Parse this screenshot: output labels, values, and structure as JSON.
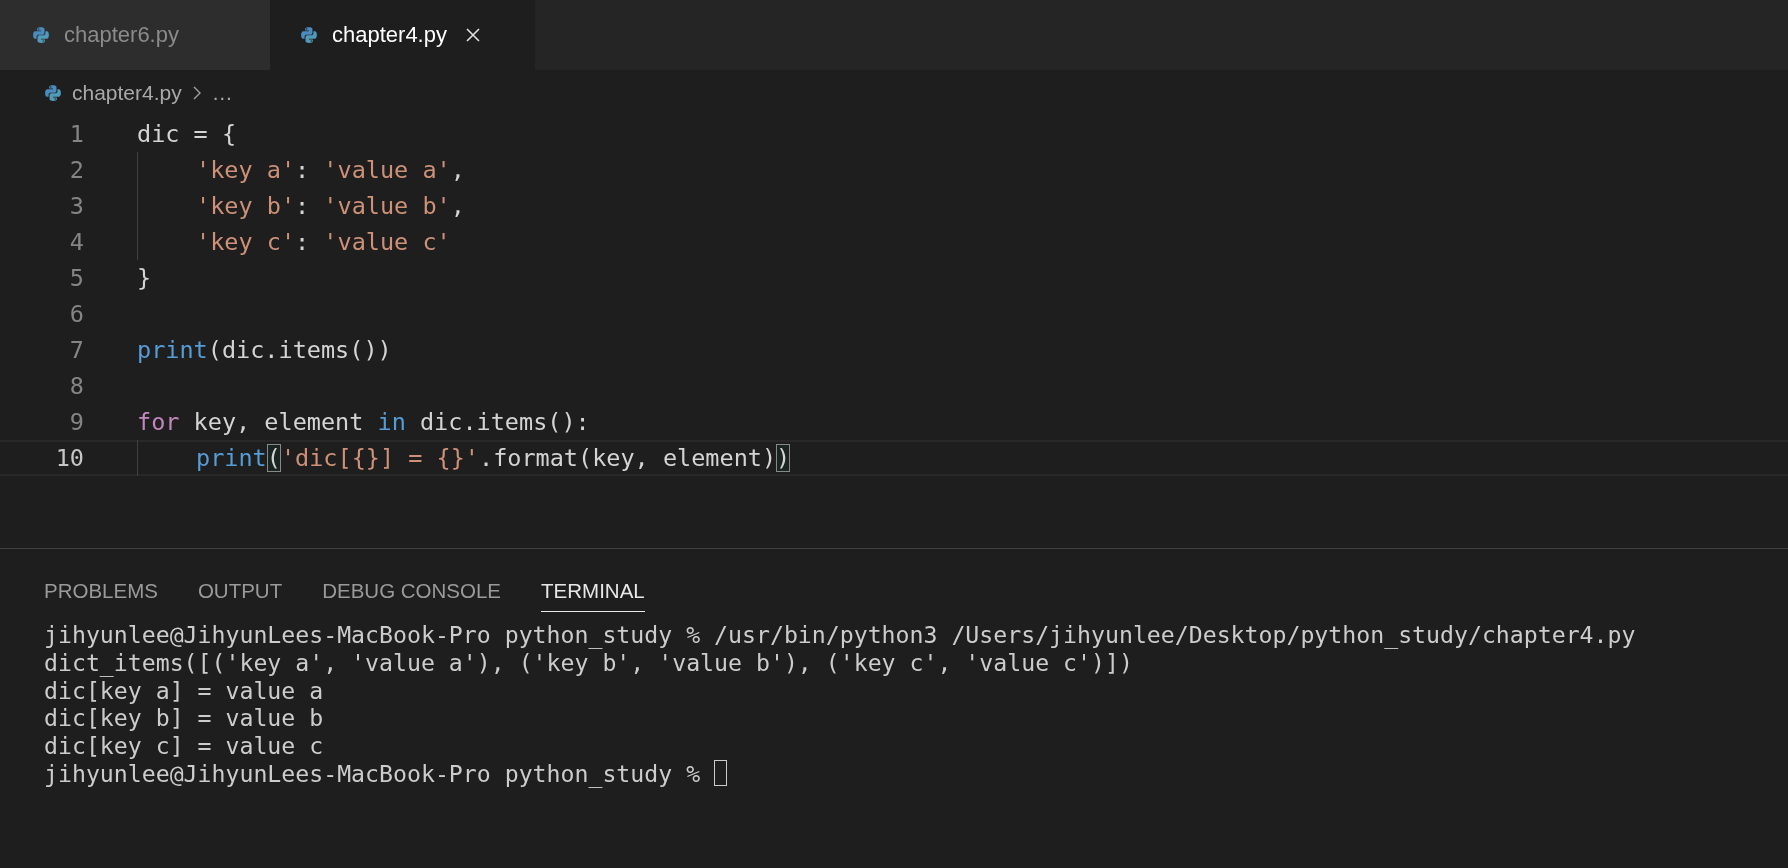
{
  "tabs": [
    {
      "label": "chapter6.py",
      "selected": false
    },
    {
      "label": "chapter4.py",
      "selected": true
    }
  ],
  "breadcrumb": {
    "file": "chapter4.py",
    "more": "…"
  },
  "code_lines": [
    {
      "number": "1",
      "current": false,
      "indented": false,
      "tokens": [
        {
          "kind": "plain",
          "text": "dic = {"
        }
      ]
    },
    {
      "number": "2",
      "current": false,
      "indented": true,
      "tokens": [
        {
          "kind": "string",
          "text": "'key a'"
        },
        {
          "kind": "plain",
          "text": ": "
        },
        {
          "kind": "string",
          "text": "'value a'"
        },
        {
          "kind": "plain",
          "text": ","
        }
      ]
    },
    {
      "number": "3",
      "current": false,
      "indented": true,
      "tokens": [
        {
          "kind": "string",
          "text": "'key b'"
        },
        {
          "kind": "plain",
          "text": ": "
        },
        {
          "kind": "string",
          "text": "'value b'"
        },
        {
          "kind": "plain",
          "text": ","
        }
      ]
    },
    {
      "number": "4",
      "current": false,
      "indented": true,
      "tokens": [
        {
          "kind": "string",
          "text": "'key c'"
        },
        {
          "kind": "plain",
          "text": ": "
        },
        {
          "kind": "string",
          "text": "'value c'"
        }
      ]
    },
    {
      "number": "5",
      "current": false,
      "indented": false,
      "tokens": [
        {
          "kind": "plain",
          "text": "}"
        }
      ]
    },
    {
      "number": "6",
      "current": false,
      "indented": false
    },
    {
      "number": "7",
      "current": false,
      "indented": false,
      "tokens": [
        {
          "kind": "function",
          "text": "print"
        },
        {
          "kind": "plain",
          "text": "(dic.items())"
        }
      ]
    },
    {
      "number": "8",
      "current": false,
      "indented": false
    },
    {
      "number": "9",
      "current": false,
      "indented": false,
      "tokens": [
        {
          "kind": "keyword",
          "text": "for"
        },
        {
          "kind": "plain",
          "text": " key, element "
        },
        {
          "kind": "operator",
          "text": "in"
        },
        {
          "kind": "plain",
          "text": " dic.items():"
        }
      ]
    },
    {
      "number": "10",
      "current": true,
      "indented": true,
      "tokens": [
        {
          "kind": "function",
          "text": "print"
        },
        {
          "kind": "match",
          "text": "("
        },
        {
          "kind": "string",
          "text": "'dic[{}] = {}'"
        },
        {
          "kind": "plain",
          "text": ".format(key, element)"
        },
        {
          "kind": "match",
          "text": ")"
        }
      ]
    }
  ],
  "panel_tabs": [
    {
      "label": "PROBLEMS",
      "selected": false
    },
    {
      "label": "OUTPUT",
      "selected": false
    },
    {
      "label": "DEBUG CONSOLE",
      "selected": false
    },
    {
      "label": "TERMINAL",
      "selected": true
    }
  ],
  "terminal": {
    "lines": [
      "jihyunlee@JihyunLees-MacBook-Pro python_study % /usr/bin/python3 /Users/jihyunlee/Desktop/python_study/chapter4.py",
      "dict_items([('key a', 'value a'), ('key b', 'value b'), ('key c', 'value c')])",
      "dic[key a] = value a",
      "dic[key b] = value b",
      "dic[key c] = value c",
      "jihyunlee@JihyunLees-MacBook-Pro python_study % "
    ],
    "cursor": true
  }
}
